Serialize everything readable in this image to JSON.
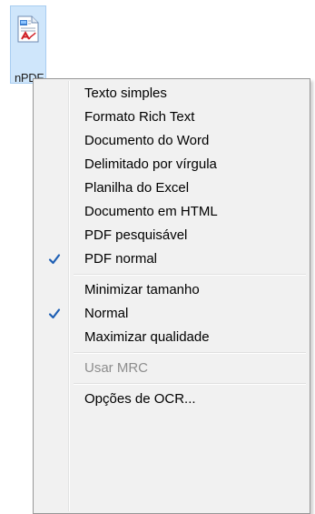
{
  "icon": {
    "name": "document-pdf-icon",
    "label": "nPDF"
  },
  "menu": {
    "groups": [
      {
        "items": [
          {
            "label": "Texto simples",
            "checked": false,
            "enabled": true
          },
          {
            "label": "Formato Rich Text",
            "checked": false,
            "enabled": true
          },
          {
            "label": "Documento do Word",
            "checked": false,
            "enabled": true
          },
          {
            "label": "Delimitado por vírgula",
            "checked": false,
            "enabled": true
          },
          {
            "label": "Planilha do Excel",
            "checked": false,
            "enabled": true
          },
          {
            "label": "Documento em HTML",
            "checked": false,
            "enabled": true
          },
          {
            "label": "PDF pesquisável",
            "checked": false,
            "enabled": true
          },
          {
            "label": "PDF normal",
            "checked": true,
            "enabled": true
          }
        ]
      },
      {
        "items": [
          {
            "label": "Minimizar tamanho",
            "checked": false,
            "enabled": true
          },
          {
            "label": "Normal",
            "checked": true,
            "enabled": true
          },
          {
            "label": "Maximizar qualidade",
            "checked": false,
            "enabled": true
          }
        ]
      },
      {
        "items": [
          {
            "label": "Usar MRC",
            "checked": false,
            "enabled": false
          }
        ]
      },
      {
        "items": [
          {
            "label": "Opções de OCR...",
            "checked": false,
            "enabled": true
          }
        ]
      }
    ]
  },
  "colors": {
    "check": "#1e5fb4",
    "menu_bg": "#f1f1f1",
    "disabled_text": "#8d8d8d",
    "icon_selection": "#cfe6fb"
  }
}
